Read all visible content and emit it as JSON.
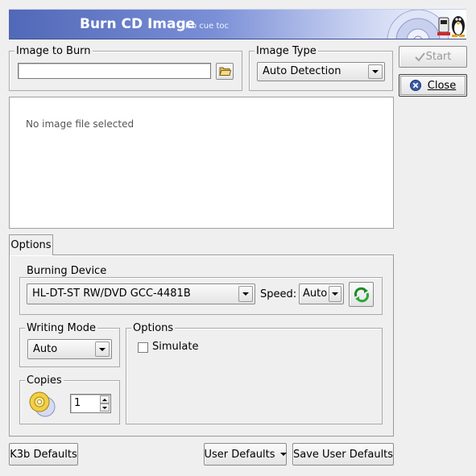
{
  "header": {
    "title": "Burn CD Image",
    "subtitle": "iso cue toc",
    "logo_icon": "k3b-penguin-cd-logo"
  },
  "image_to_burn": {
    "group_title": "Image to Burn",
    "path_value": "",
    "browse_icon": "folder-open-icon"
  },
  "image_type": {
    "group_title": "Image Type",
    "selected": "Auto Detection"
  },
  "actions": {
    "start_label": "Start",
    "start_icon": "check-icon",
    "close_label": "Close",
    "close_icon": "close-circle-icon"
  },
  "preview": {
    "message": "No image file selected"
  },
  "tabs": [
    {
      "label": "Options",
      "active": true
    }
  ],
  "burning_device": {
    "group_title": "Burning Device",
    "device": "HL-DT-ST RW/DVD GCC-4481B",
    "speed_label": "Speed:",
    "speed": "Auto",
    "refresh_icon": "refresh-device-icon"
  },
  "writing_mode": {
    "group_title": "Writing Mode",
    "selected": "Auto"
  },
  "options": {
    "group_title": "Options",
    "simulate_label": "Simulate",
    "simulate_checked": false
  },
  "copies": {
    "group_title": "Copies",
    "value": "1",
    "icon": "cd-copies-icon"
  },
  "footer": {
    "k3b_defaults": "K3b Defaults",
    "user_defaults": "User Defaults",
    "save_user_defaults": "Save User Defaults"
  },
  "colors": {
    "banner_start": "#5168b8",
    "banner_end": "#ffffff",
    "window_bg": "#efefef"
  }
}
